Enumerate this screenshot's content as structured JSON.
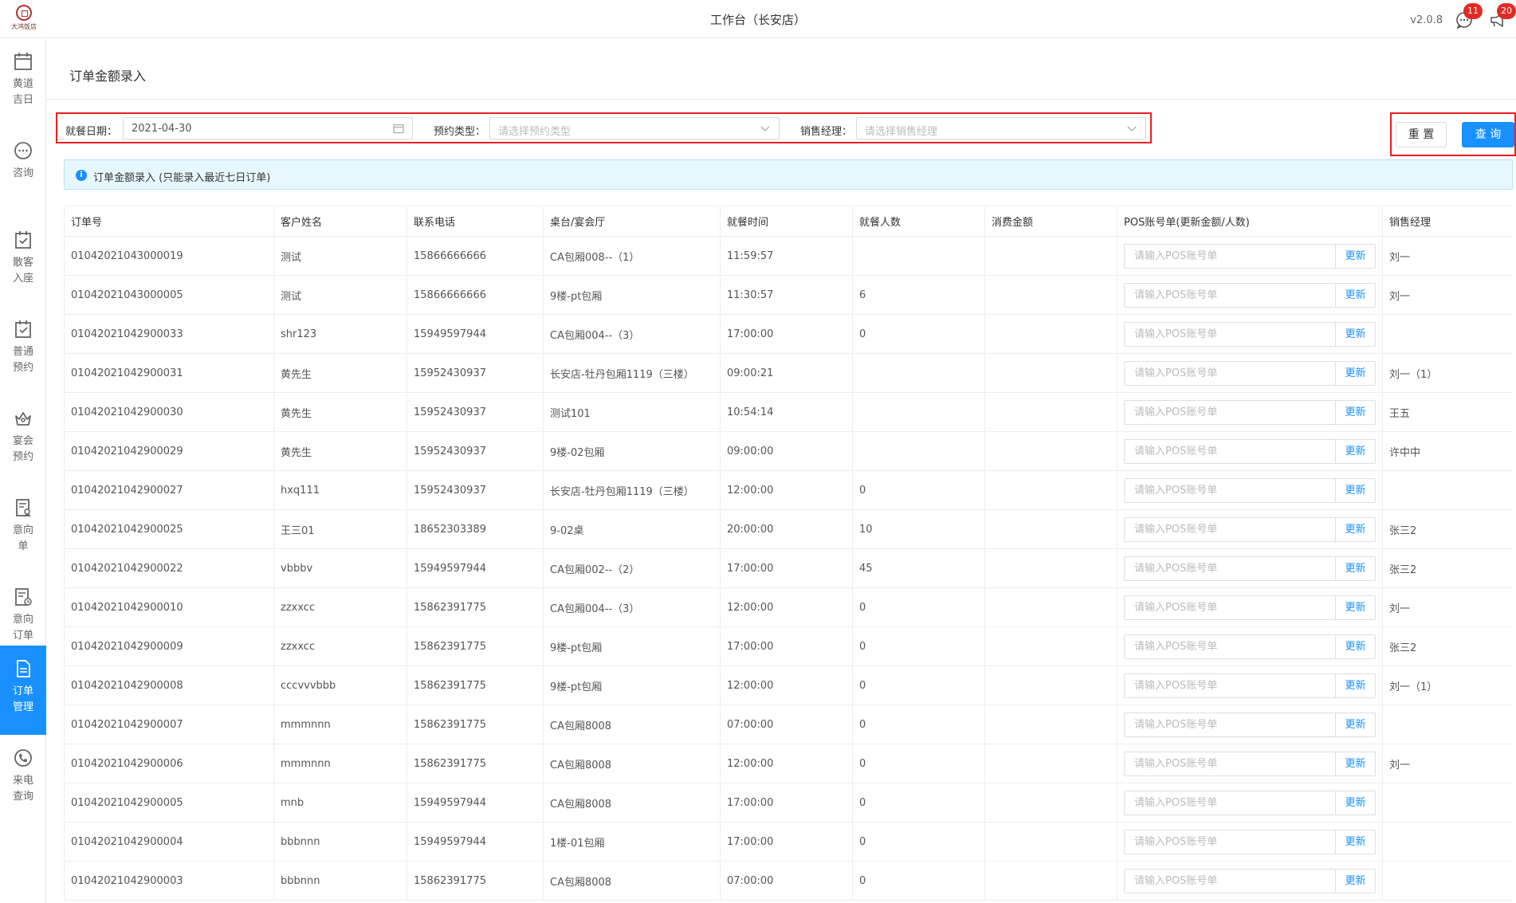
{
  "app": {
    "title": "工作台（长安店）",
    "version": "v2.0.8",
    "chat_badge": "11",
    "notice_badge": "20"
  },
  "sidebar": {
    "items": [
      {
        "label": "黄道吉日",
        "icon": "calendar-icon",
        "active": false
      },
      {
        "label": "咨询",
        "icon": "chat-bubble-icon",
        "active": false
      },
      {
        "label": "散客入座",
        "icon": "checkin-icon",
        "active": false
      },
      {
        "label": "普通预约",
        "icon": "reserve-icon",
        "active": false
      },
      {
        "label": "宴会预约",
        "icon": "banquet-icon",
        "active": false
      },
      {
        "label": "意向单",
        "icon": "intent-doc-icon",
        "active": false
      },
      {
        "label": "意向订单",
        "icon": "intent-order-icon",
        "active": false
      },
      {
        "label": "订单管理",
        "icon": "order-doc-icon",
        "active": true
      },
      {
        "label": "来电查询",
        "icon": "phone-icon",
        "active": false
      }
    ]
  },
  "page": {
    "title": "订单金额录入"
  },
  "filters": {
    "date_label": "就餐日期：",
    "date_value": "2021-04-30",
    "type_label": "预约类型：",
    "type_placeholder": "请选择预约类型",
    "manager_label": "销售经理：",
    "manager_placeholder": "请选择销售经理"
  },
  "buttons": {
    "reset": "重 置",
    "query": "查 询"
  },
  "info": {
    "text": "订单金额录入 (只能录入最近七日订单)"
  },
  "table": {
    "headers": [
      "订单号",
      "客户姓名",
      "联系电话",
      "桌台/宴会厅",
      "就餐时间",
      "就餐人数",
      "消费金额",
      "POS账号单(更新金额/人数)",
      "销售经理"
    ],
    "pos_placeholder": "请输入POS账号单",
    "update_label": "更新",
    "rows": [
      {
        "order_no": "01042021043000019",
        "customer": "测试",
        "phone": "15866666666",
        "table": "CA包厢008--（1）",
        "time": "11:59:57",
        "guests": "",
        "amount": "",
        "manager": "刘一"
      },
      {
        "order_no": "01042021043000005",
        "customer": "测试",
        "phone": "15866666666",
        "table": "9楼-pt包厢",
        "time": "11:30:57",
        "guests": "6",
        "amount": "",
        "manager": "刘一"
      },
      {
        "order_no": "01042021042900033",
        "customer": "shr123",
        "phone": "15949597944",
        "table": "CA包厢004--（3）",
        "time": "17:00:00",
        "guests": "0",
        "amount": "",
        "manager": ""
      },
      {
        "order_no": "01042021042900031",
        "customer": "黄先生",
        "phone": "15952430937",
        "table": "长安店-牡丹包厢1119（三楼）",
        "time": "09:00:21",
        "guests": "",
        "amount": "",
        "manager": "刘一（1）"
      },
      {
        "order_no": "01042021042900030",
        "customer": "黄先生",
        "phone": "15952430937",
        "table": "测试101",
        "time": "10:54:14",
        "guests": "",
        "amount": "",
        "manager": "王五"
      },
      {
        "order_no": "01042021042900029",
        "customer": "黄先生",
        "phone": "15952430937",
        "table": "9楼-02包厢",
        "time": "09:00:00",
        "guests": "",
        "amount": "",
        "manager": "许中中"
      },
      {
        "order_no": "01042021042900027",
        "customer": "hxq111",
        "phone": "15952430937",
        "table": "长安店-牡丹包厢1119（三楼）",
        "time": "12:00:00",
        "guests": "0",
        "amount": "",
        "manager": ""
      },
      {
        "order_no": "01042021042900025",
        "customer": "王三01",
        "phone": "18652303389",
        "table": "9-02桌",
        "time": "20:00:00",
        "guests": "10",
        "amount": "",
        "manager": "张三2"
      },
      {
        "order_no": "01042021042900022",
        "customer": "vbbbv",
        "phone": "15949597944",
        "table": "CA包厢002--（2）",
        "time": "17:00:00",
        "guests": "45",
        "amount": "",
        "manager": "张三2"
      },
      {
        "order_no": "01042021042900010",
        "customer": "zzxxcc",
        "phone": "15862391775",
        "table": "CA包厢004--（3）",
        "time": "12:00:00",
        "guests": "0",
        "amount": "",
        "manager": "刘一"
      },
      {
        "order_no": "01042021042900009",
        "customer": "zzxxcc",
        "phone": "15862391775",
        "table": "9楼-pt包厢",
        "time": "17:00:00",
        "guests": "0",
        "amount": "",
        "manager": "张三2"
      },
      {
        "order_no": "01042021042900008",
        "customer": "cccvvvbbb",
        "phone": "15862391775",
        "table": "9楼-pt包厢",
        "time": "12:00:00",
        "guests": "0",
        "amount": "",
        "manager": "刘一（1）"
      },
      {
        "order_no": "01042021042900007",
        "customer": "mmmnnn",
        "phone": "15862391775",
        "table": "CA包厢8008",
        "time": "07:00:00",
        "guests": "0",
        "amount": "",
        "manager": ""
      },
      {
        "order_no": "01042021042900006",
        "customer": "mmmnnn",
        "phone": "15862391775",
        "table": "CA包厢8008",
        "time": "12:00:00",
        "guests": "0",
        "amount": "",
        "manager": "刘一"
      },
      {
        "order_no": "01042021042900005",
        "customer": "mnb",
        "phone": "15949597944",
        "table": "CA包厢8008",
        "time": "17:00:00",
        "guests": "0",
        "amount": "",
        "manager": ""
      },
      {
        "order_no": "01042021042900004",
        "customer": "bbbnnn",
        "phone": "15949597944",
        "table": "1楼-01包厢",
        "time": "17:00:00",
        "guests": "0",
        "amount": "",
        "manager": ""
      },
      {
        "order_no": "01042021042900003",
        "customer": "bbbnnn",
        "phone": "15862391775",
        "table": "CA包厢8008",
        "time": "07:00:00",
        "guests": "0",
        "amount": "",
        "manager": ""
      }
    ]
  },
  "colors": {
    "primary": "#1890ff",
    "highlight_border": "#e81e25",
    "badge": "#e02a26",
    "info_bg": "#e6f7ff"
  }
}
